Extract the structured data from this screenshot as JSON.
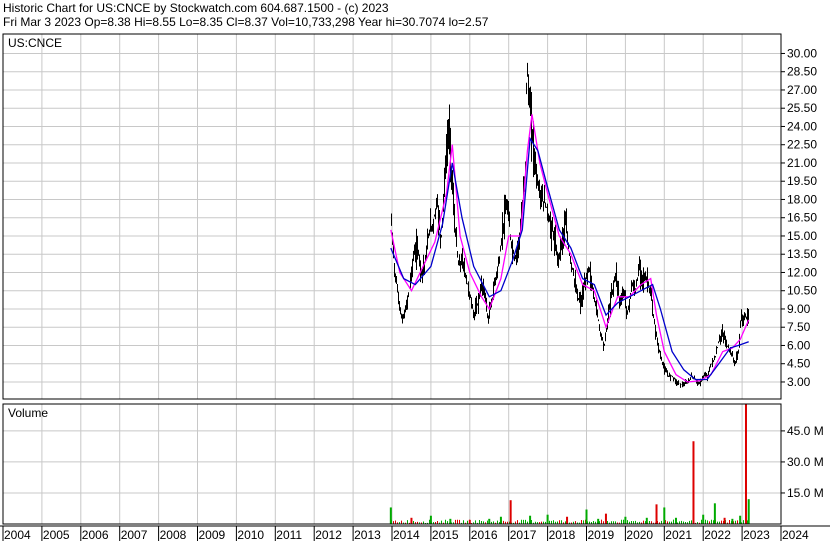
{
  "header": {
    "line1": "Historic Chart for US:CNCE by Stockwatch.com 604.687.1500 - (c) 2023",
    "line2": "Fri Mar  3 2023   Op=8.38  Hi=8.55  Lo=8.35  Cl=8.37  Vol=10,733,298  Year hi=30.7074  lo=2.57"
  },
  "colors": {
    "price_bars": "#000000",
    "ma_short": "#ff00ff",
    "ma_long": "#0000cc",
    "volume_up": "#00aa00",
    "volume_down": "#dd0000",
    "grid": "#c8c8c8"
  },
  "chart_data": [
    {
      "type": "line",
      "title": "US:CNCE",
      "y_tick_labels": [
        "30.00",
        "28.50",
        "27.00",
        "25.50",
        "24.00",
        "22.50",
        "21.00",
        "19.50",
        "18.00",
        "16.50",
        "15.00",
        "13.50",
        "12.00",
        "10.50",
        "9.00",
        "7.50",
        "6.00",
        "4.50",
        "3.00"
      ],
      "ylim": [
        1.6,
        31.6
      ],
      "x_tick_labels": [
        "2004",
        "2005",
        "2006",
        "2007",
        "2008",
        "2009",
        "2010",
        "2011",
        "2012",
        "2013",
        "2014",
        "2015",
        "2016",
        "2017",
        "2018",
        "2019",
        "2020",
        "2021",
        "2022",
        "2023",
        "2024"
      ],
      "xlim": [
        2004.0,
        2024.0
      ],
      "grid": true,
      "series": [
        {
          "x": [
            2013.97,
            2014.05,
            2014.15,
            2014.25,
            2014.35,
            2014.45,
            2014.55,
            2014.65,
            2014.75,
            2014.85,
            2014.95,
            2015.05,
            2015.15,
            2015.25,
            2015.35,
            2015.45,
            2015.5,
            2015.6,
            2015.7,
            2015.8,
            2015.9,
            2016.0,
            2016.1,
            2016.2,
            2016.3,
            2016.4,
            2016.45,
            2016.55,
            2016.65,
            2016.75,
            2016.85,
            2016.95,
            2017.05,
            2017.15,
            2017.25,
            2017.35,
            2017.42,
            2017.45,
            2017.55,
            2017.65,
            2017.75,
            2017.85,
            2017.95,
            2018.05,
            2018.15,
            2018.25,
            2018.35,
            2018.45,
            2018.55,
            2018.65,
            2018.75,
            2018.85,
            2018.95,
            2019.05,
            2019.15,
            2019.25,
            2019.35,
            2019.45,
            2019.55,
            2019.65,
            2019.75,
            2019.85,
            2019.95,
            2020.05,
            2020.15,
            2020.25,
            2020.35,
            2020.45,
            2020.55,
            2020.65,
            2020.7,
            2020.8,
            2020.9,
            2021.0,
            2021.1,
            2021.2,
            2021.3,
            2021.4,
            2021.5,
            2021.6,
            2021.7,
            2021.8,
            2021.9,
            2022.0,
            2022.1,
            2022.2,
            2022.3,
            2022.4,
            2022.5,
            2022.6,
            2022.7,
            2022.75,
            2022.8,
            2022.85,
            2022.9,
            2022.95,
            2023.0,
            2023.05,
            2023.1,
            2023.17
          ],
          "y": [
            16.2,
            12.5,
            10.0,
            8.0,
            9.0,
            11.0,
            13.5,
            14.0,
            12.0,
            13.0,
            15.5,
            16.0,
            18.0,
            14.5,
            20.0,
            24.0,
            21.5,
            16.0,
            12.5,
            13.0,
            11.5,
            10.0,
            8.5,
            9.5,
            11.0,
            10.0,
            8.0,
            9.5,
            11.5,
            13.0,
            16.0,
            17.5,
            14.5,
            13.0,
            14.5,
            17.5,
            21.0,
            29.0,
            25.0,
            21.5,
            19.0,
            18.0,
            17.5,
            16.0,
            15.0,
            13.0,
            14.5,
            16.0,
            13.5,
            12.0,
            10.0,
            9.5,
            11.0,
            12.5,
            10.5,
            9.0,
            7.0,
            6.0,
            8.5,
            10.5,
            12.0,
            9.5,
            10.5,
            8.5,
            11.0,
            10.5,
            12.5,
            11.5,
            11.5,
            10.0,
            8.5,
            6.5,
            5.0,
            4.0,
            3.5,
            3.5,
            3.0,
            2.8,
            2.8,
            3.0,
            3.5,
            3.2,
            2.8,
            3.5,
            3.5,
            4.5,
            5.0,
            6.5,
            7.0,
            6.0,
            5.5,
            5.0,
            4.5,
            5.0,
            5.5,
            8.0,
            8.2,
            8.4,
            8.3,
            8.37
          ]
        },
        {
          "name": "",
          "x": [
            2013.97,
            2014.2,
            2014.5,
            2014.8,
            2015.1,
            2015.4,
            2015.55,
            2015.75,
            2016.0,
            2016.3,
            2016.5,
            2016.8,
            2017.0,
            2017.3,
            2017.48,
            2017.6,
            2017.8,
            2018.0,
            2018.3,
            2018.6,
            2018.9,
            2019.2,
            2019.5,
            2019.8,
            2020.1,
            2020.4,
            2020.65,
            2020.8,
            2021.0,
            2021.3,
            2021.6,
            2021.9,
            2022.2,
            2022.5,
            2022.75,
            2022.95,
            2023.17
          ],
          "y": [
            15.5,
            12.0,
            10.5,
            12.5,
            14.5,
            18.5,
            22.5,
            15.0,
            12.0,
            10.0,
            9.0,
            11.5,
            15.0,
            15.0,
            22.0,
            25.0,
            21.0,
            18.5,
            15.0,
            13.5,
            11.0,
            10.5,
            7.5,
            10.0,
            10.0,
            11.0,
            11.5,
            8.5,
            5.5,
            3.6,
            3.0,
            3.1,
            3.6,
            5.5,
            5.8,
            6.5,
            8.1
          ]
        },
        {
          "name": "",
          "x": [
            2013.97,
            2014.3,
            2014.6,
            2015.0,
            2015.3,
            2015.55,
            2015.8,
            2016.1,
            2016.5,
            2016.8,
            2017.1,
            2017.35,
            2017.55,
            2017.75,
            2018.0,
            2018.3,
            2018.6,
            2018.9,
            2019.2,
            2019.5,
            2019.8,
            2020.1,
            2020.4,
            2020.7,
            2020.9,
            2021.2,
            2021.5,
            2021.8,
            2022.1,
            2022.4,
            2022.7,
            2022.9,
            2023.17
          ],
          "y": [
            14.0,
            11.5,
            11.0,
            12.5,
            16.0,
            21.0,
            16.5,
            12.5,
            10.0,
            10.5,
            13.0,
            15.5,
            23.0,
            22.0,
            19.0,
            15.5,
            14.0,
            11.5,
            11.0,
            8.5,
            9.5,
            10.0,
            10.5,
            11.0,
            9.0,
            5.5,
            4.0,
            3.2,
            3.2,
            4.5,
            5.8,
            6.0,
            6.3
          ]
        }
      ]
    },
    {
      "type": "bar",
      "title": "Volume",
      "y_tick_labels": [
        "45.0 M",
        "30.0 M",
        "15.0 M"
      ],
      "ylim": [
        0,
        58
      ],
      "x": [
        2013.97,
        2014.5,
        2015.0,
        2015.5,
        2016.0,
        2016.5,
        2016.8,
        2017.05,
        2017.55,
        2018.0,
        2018.5,
        2019.0,
        2019.3,
        2019.5,
        2020.0,
        2020.55,
        2020.8,
        2021.0,
        2021.3,
        2021.75,
        2022.0,
        2022.3,
        2022.55,
        2022.75,
        2022.95,
        2023.1,
        2023.17
      ],
      "values": [
        8.0,
        3.0,
        4.0,
        2.5,
        2.0,
        2.5,
        3.5,
        11.5,
        4.0,
        4.5,
        3.5,
        7.0,
        2.5,
        5.0,
        3.5,
        3.0,
        9.5,
        8.0,
        3.0,
        40.0,
        4.5,
        10.0,
        3.0,
        2.5,
        4.0,
        58.0,
        12.0
      ]
    }
  ]
}
